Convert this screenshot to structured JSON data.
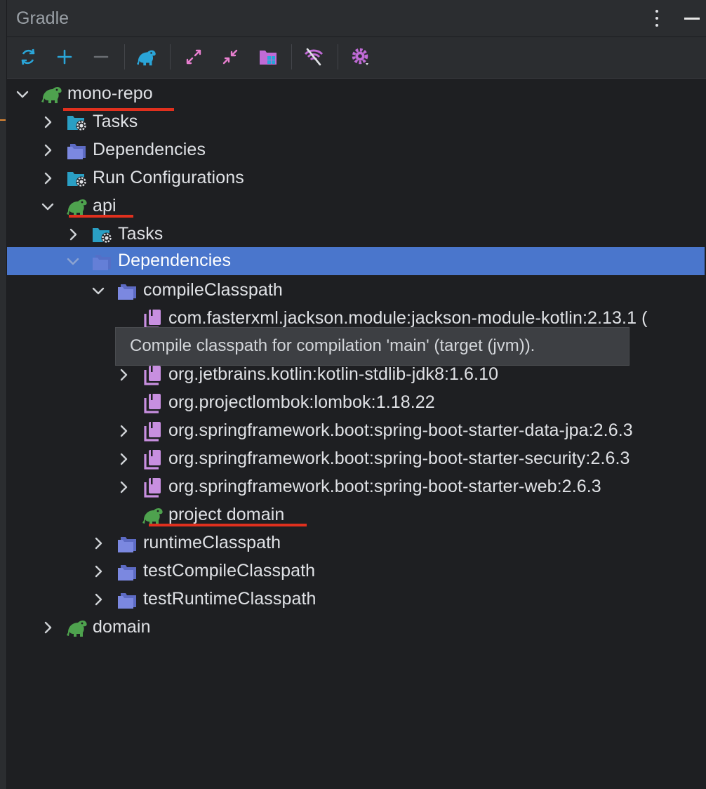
{
  "panel": {
    "title": "Gradle"
  },
  "toolbar": {
    "buttons": [
      "reload-all-icon",
      "add-icon",
      "remove-icon",
      "gradle-elephant-icon",
      "expand-all-icon",
      "collapse-all-icon",
      "module-group-icon",
      "offline-mode-icon",
      "settings-icon"
    ]
  },
  "tree": {
    "rows": [
      {
        "label": "mono-repo",
        "expanded": true
      },
      {
        "label": "Tasks",
        "expanded": false
      },
      {
        "label": "Dependencies",
        "expanded": false
      },
      {
        "label": "Run Configurations",
        "expanded": false
      },
      {
        "label": "api",
        "expanded": true
      },
      {
        "label": "Tasks",
        "expanded": false
      },
      {
        "label": "Dependencies",
        "expanded": true,
        "selected": true
      },
      {
        "label": "compileClasspath",
        "expanded": true
      },
      {
        "label": "com.fasterxml.jackson.module:jackson-module-kotlin:2.13.1 ("
      },
      {
        "label": ""
      },
      {
        "label": "org.jetbrains.kotlin:kotlin-stdlib-jdk8:1.6.10",
        "expanded": false
      },
      {
        "label": "org.projectlombok:lombok:1.18.22"
      },
      {
        "label": "org.springframework.boot:spring-boot-starter-data-jpa:2.6.3",
        "expanded": false
      },
      {
        "label": "org.springframework.boot:spring-boot-starter-security:2.6.3",
        "expanded": false
      },
      {
        "label": "org.springframework.boot:spring-boot-starter-web:2.6.3",
        "expanded": false
      },
      {
        "label": "project domain"
      },
      {
        "label": "runtimeClasspath",
        "expanded": false
      },
      {
        "label": "testCompileClasspath",
        "expanded": false
      },
      {
        "label": "testRuntimeClasspath",
        "expanded": false
      },
      {
        "label": "domain",
        "expanded": false
      }
    ]
  },
  "tooltip": {
    "text": "Compile classpath for compilation 'main' (target (jvm))."
  },
  "colors": {
    "background": "#1e1f22",
    "selection": "#4a76cc",
    "underline": "#e0301e",
    "gradle_green": "#4ea24e",
    "folder_blue": "#6f7fd8",
    "library_pink": "#c88fe0"
  }
}
